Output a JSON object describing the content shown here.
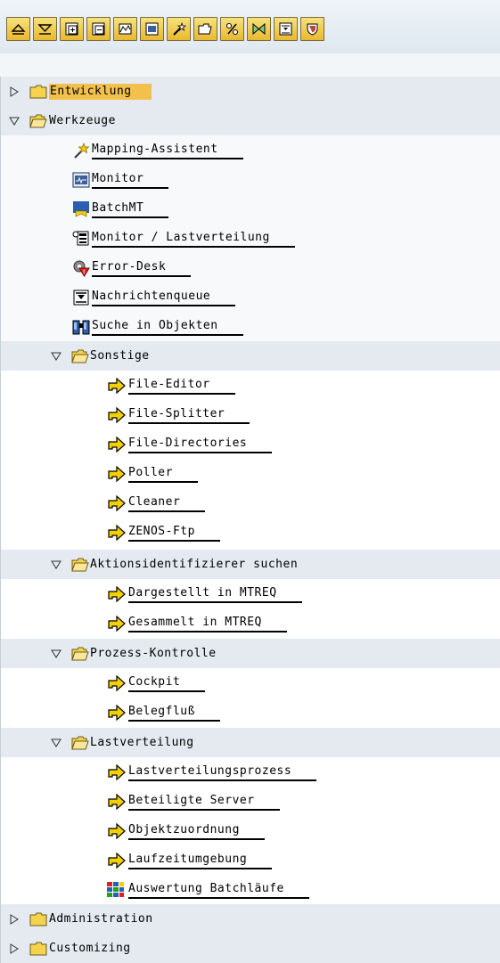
{
  "toolbar": {
    "buttons": [
      {
        "icon": "expand-all-icon"
      },
      {
        "icon": "collapse-all-icon"
      },
      {
        "icon": "expand-subtree-icon"
      },
      {
        "icon": "collapse-subtree-icon"
      },
      {
        "icon": "chart-icon"
      },
      {
        "icon": "display-icon"
      },
      {
        "icon": "wizard-icon"
      },
      {
        "icon": "open-folder-icon"
      },
      {
        "icon": "percent-icon"
      },
      {
        "icon": "bowtie-icon"
      },
      {
        "icon": "queue-icon"
      },
      {
        "icon": "shield-icon"
      }
    ]
  },
  "tree": {
    "entwicklung": "Entwicklung",
    "werkzeuge": "Werkzeuge",
    "mapping_assistent": "Mapping-Assistent",
    "monitor": "Monitor",
    "batchmt": "BatchMT",
    "monitor_lastverteilung": "Monitor / Lastverteilung",
    "error_desk": "Error-Desk",
    "nachrichtenqueue": "Nachrichtenqueue",
    "suche_in_objekten": "Suche in Objekten",
    "sonstige": "Sonstige",
    "file_editor": "File-Editor",
    "file_splitter": "File-Splitter",
    "file_directories": "File-Directories",
    "poller": "Poller",
    "cleaner": "Cleaner",
    "zenos_ftp": "ZENOS-Ftp",
    "aktionsidentifizierer": "Aktionsidentifizierer suchen",
    "dargestellt": "Dargestellt in MTREQ",
    "gesammelt": "Gesammelt in MTREQ",
    "prozess_kontrolle": "Prozess-Kontrolle",
    "cockpit": "Cockpit",
    "belegfluss": "Belegfluß",
    "lastverteilung": "Lastverteilung",
    "lastverteilungsprozess": "Lastverteilungsprozess",
    "beteiligte_server": "Beteiligte Server",
    "objektzuordnung": "Objektzuordnung",
    "laufzeitumgebung": "Laufzeitumgebung",
    "auswertung_batchlaeufe": "Auswertung Batchläufe",
    "administration": "Administration",
    "customizing": "Customizing"
  }
}
